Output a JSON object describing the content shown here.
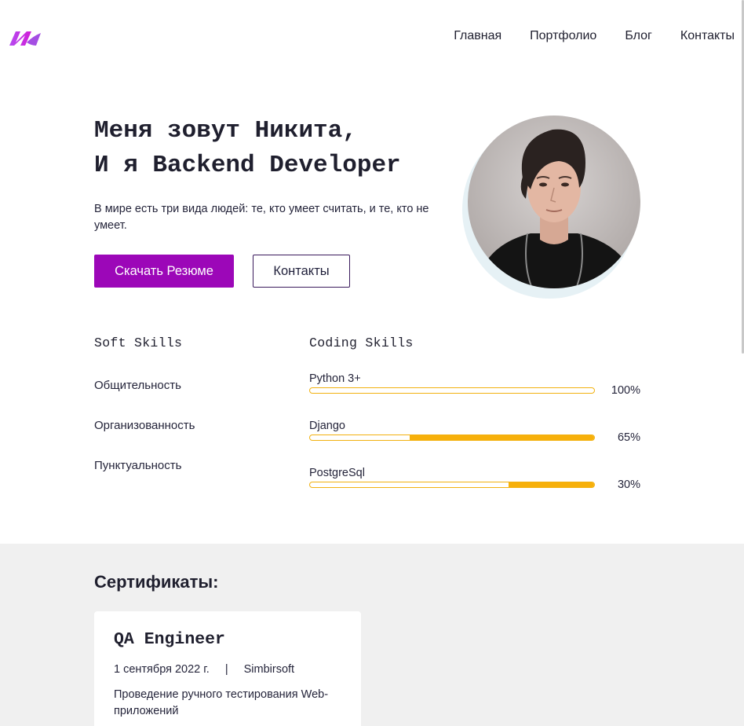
{
  "header": {
    "logo_icon": "brand-logo-icon",
    "nav": [
      "Главная",
      "Портфолио",
      "Блог",
      "Контакты"
    ]
  },
  "hero": {
    "title": "Меня зовут Никита,\nИ я Backend Developer",
    "text": "В мире есть три вида людей: те, кто умеет считать, и те, кто не умеет.",
    "primary_button": "Скачать Резюме",
    "secondary_button": "Контакты",
    "accent": "#9c07b8"
  },
  "skills": {
    "soft_title": "Soft Skills",
    "soft": [
      "Общительность",
      "Организованность",
      "Пунктуальность"
    ],
    "coding_title": "Coding Skills",
    "coding": [
      {
        "name": "Python 3+",
        "level": 100,
        "label": "100%"
      },
      {
        "name": "Django",
        "level": 65,
        "label": "65%"
      },
      {
        "name": "PostgreSql",
        "level": 30,
        "label": "30%"
      }
    ],
    "bar_color": "#f7b00a"
  },
  "certificates": {
    "heading": "Сертификаты:",
    "items": [
      {
        "title": "QA Engineer",
        "date": "1 сентября 2022 г.",
        "separator": "|",
        "org": "Simbirsoft",
        "description": "Проведение ручного тестирования Web-приложений"
      }
    ]
  }
}
